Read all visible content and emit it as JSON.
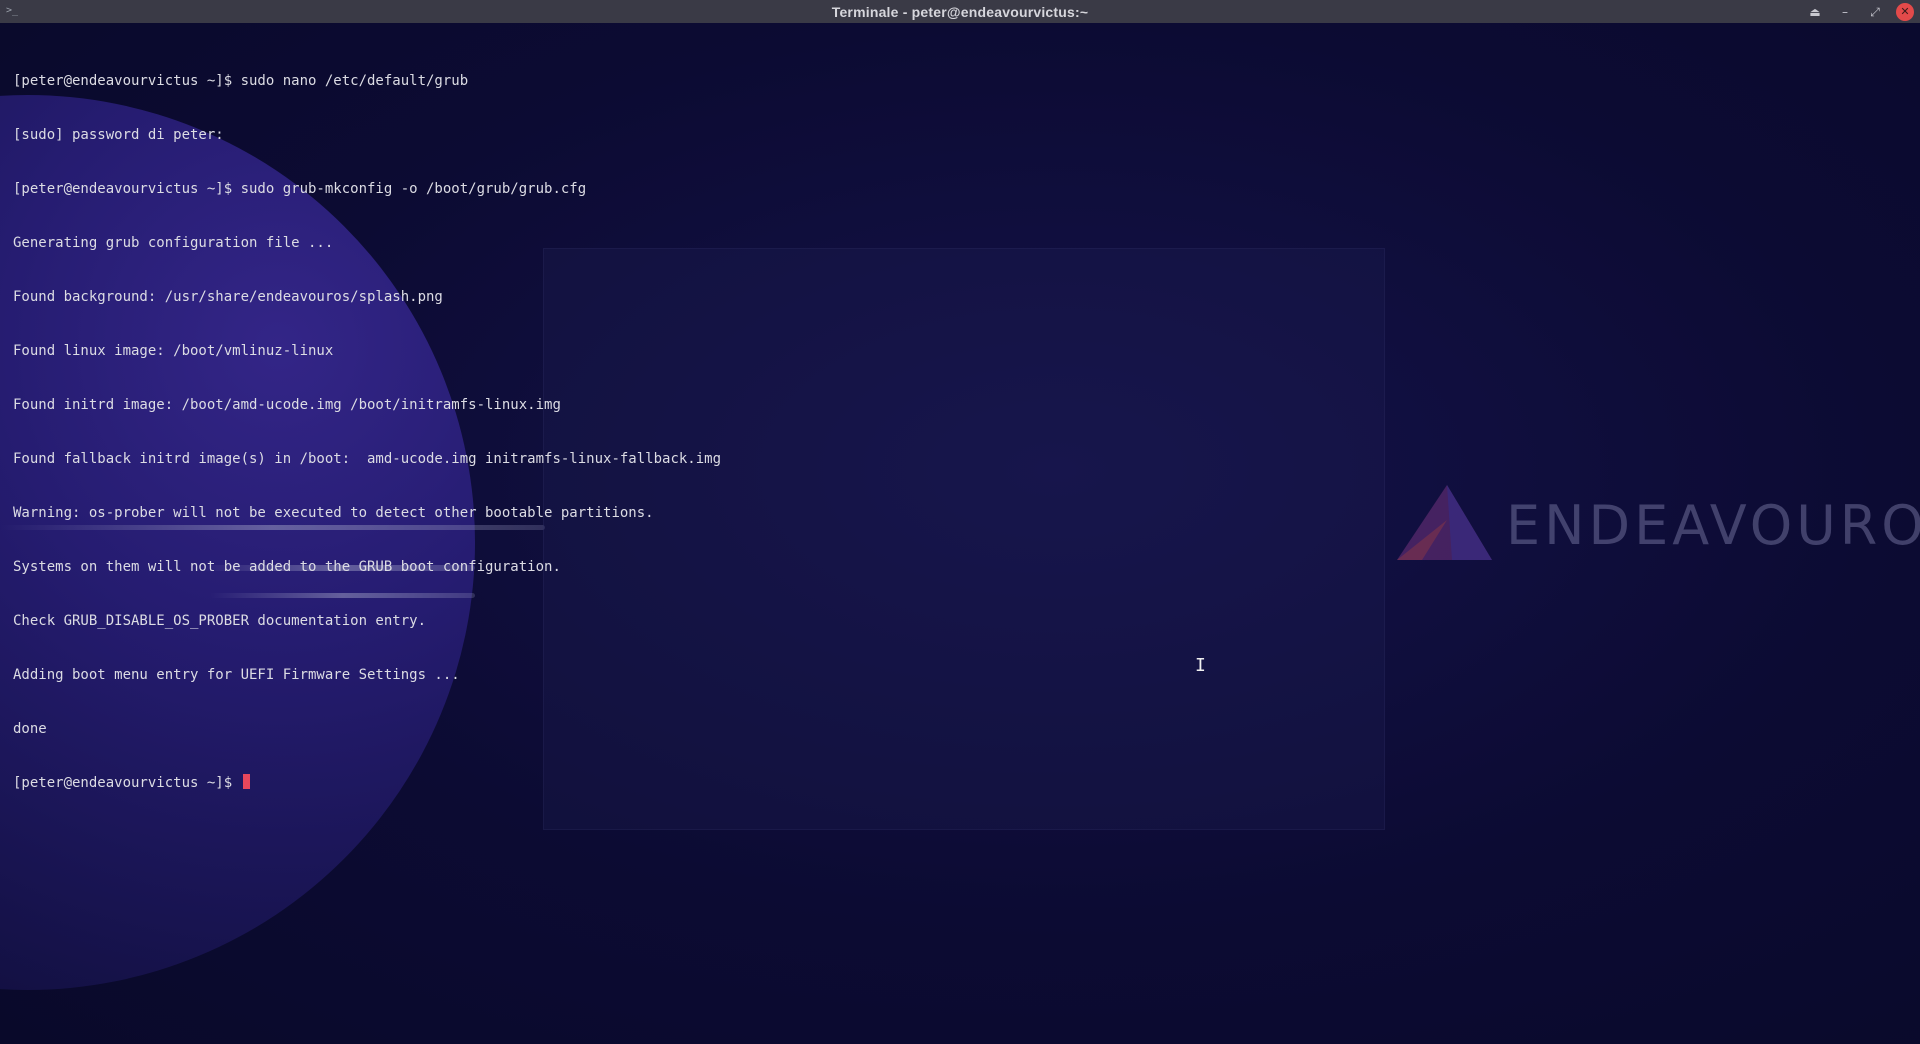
{
  "window": {
    "title": "Terminale - peter@endeavourvictus:~",
    "icons": {
      "app": "terminal-icon",
      "keep_above": "eject-icon",
      "minimize": "minimize-icon",
      "maximize": "maximize-icon",
      "close": "close-icon"
    },
    "glyphs": {
      "app": ">_",
      "keep_above": "⏏",
      "minimize": "–",
      "maximize": "⤢",
      "close": "✕"
    }
  },
  "terminal": {
    "lines": [
      "[peter@endeavourvictus ~]$ sudo nano /etc/default/grub",
      "[sudo] password di peter:",
      "[peter@endeavourvictus ~]$ sudo grub-mkconfig -o /boot/grub/grub.cfg",
      "Generating grub configuration file ...",
      "Found background: /usr/share/endeavouros/splash.png",
      "Found linux image: /boot/vmlinuz-linux",
      "Found initrd image: /boot/amd-ucode.img /boot/initramfs-linux.img",
      "Found fallback initrd image(s) in /boot:  amd-ucode.img initramfs-linux-fallback.img",
      "Warning: os-prober will not be executed to detect other bootable partitions.",
      "Systems on them will not be added to the GRUB boot configuration.",
      "Check GRUB_DISABLE_OS_PROBER documentation entry.",
      "Adding boot menu entry for UEFI Firmware Settings ...",
      "done"
    ],
    "prompt": "[peter@endeavourvictus ~]$ ",
    "cursor_color": "#e8475c"
  },
  "background": {
    "logo_text": "ENDEAVOUROS",
    "logo_icon": "endeavouros-logo-icon",
    "pointer_icon": "ibeam-cursor-icon",
    "pointer_glyph": "I"
  },
  "colors": {
    "titlebar": "#3a3a46",
    "text": "#dcdce4",
    "close_button": "#e34a4a"
  }
}
